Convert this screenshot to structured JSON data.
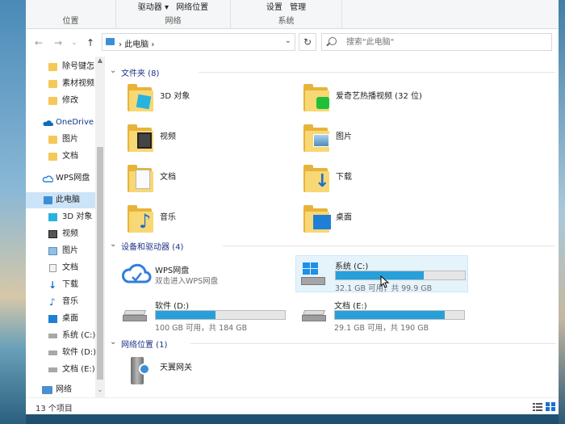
{
  "ribbon": {
    "groups": [
      {
        "label": "位置",
        "cmds": []
      },
      {
        "label": "网络",
        "cmds": [
          "驱动器 ▾",
          "网络位置"
        ]
      },
      {
        "label": "系统",
        "cmds": [
          "设置",
          "管理"
        ]
      }
    ]
  },
  "address": {
    "crumb_arrow": "›",
    "location": "此电脑",
    "location_arrow": "›",
    "dropdown": "⌄",
    "refresh": "↻"
  },
  "search": {
    "placeholder": "搜索\"此电脑\""
  },
  "sidebar": {
    "items": [
      {
        "label": "除号键怎",
        "icon": "folder-icon"
      },
      {
        "label": "素材视频",
        "icon": "folder-icon"
      },
      {
        "label": "修改",
        "icon": "folder-icon"
      },
      {
        "label": "OneDrive",
        "icon": "cloud-icon"
      },
      {
        "label": "图片",
        "icon": "folder-icon"
      },
      {
        "label": "文档",
        "icon": "folder-icon"
      },
      {
        "label": "WPS网盘",
        "icon": "wps-cloud-icon"
      },
      {
        "label": "此电脑",
        "icon": "computer-icon"
      },
      {
        "label": "3D 对象",
        "icon": "cube-icon"
      },
      {
        "label": "视频",
        "icon": "video-icon"
      },
      {
        "label": "图片",
        "icon": "picture-icon"
      },
      {
        "label": "文档",
        "icon": "document-icon"
      },
      {
        "label": "下载",
        "icon": "download-icon"
      },
      {
        "label": "音乐",
        "icon": "music-icon"
      },
      {
        "label": "桌面",
        "icon": "desktop-icon"
      },
      {
        "label": "系统 (C:)",
        "icon": "drive-icon"
      },
      {
        "label": "软件 (D:)",
        "icon": "drive-icon"
      },
      {
        "label": "文档 (E:)",
        "icon": "drive-icon"
      },
      {
        "label": "网络",
        "icon": "network-icon"
      }
    ]
  },
  "sections": {
    "folders": "文件夹 (8)",
    "devices": "设备和驱动器 (4)",
    "network": "网络位置 (1)"
  },
  "folders": [
    {
      "label": "3D 对象"
    },
    {
      "label": "爱奇艺热播视频 (32 位)"
    },
    {
      "label": "视频"
    },
    {
      "label": "图片"
    },
    {
      "label": "文档"
    },
    {
      "label": "下载"
    },
    {
      "label": "音乐"
    },
    {
      "label": "桌面"
    }
  ],
  "drives": [
    {
      "label": "WPS网盘",
      "sub": "双击进入WPS网盘"
    },
    {
      "label": "系统 (C:)",
      "space": "32.1 GB 可用，共 99.9 GB",
      "used_fraction": 0.68
    },
    {
      "label": "软件 (D:)",
      "space": "100 GB 可用，共 184 GB",
      "used_fraction": 0.46
    },
    {
      "label": "文档 (E:)",
      "space": "29.1 GB 可用，共 190 GB",
      "used_fraction": 0.85
    }
  ],
  "network_items": [
    {
      "label": "天翼网关"
    }
  ],
  "status": {
    "count": "13 个项目"
  },
  "colors": {
    "accent": "#26a0da",
    "selected": "#cce4f7",
    "folder": "#f8d775"
  }
}
